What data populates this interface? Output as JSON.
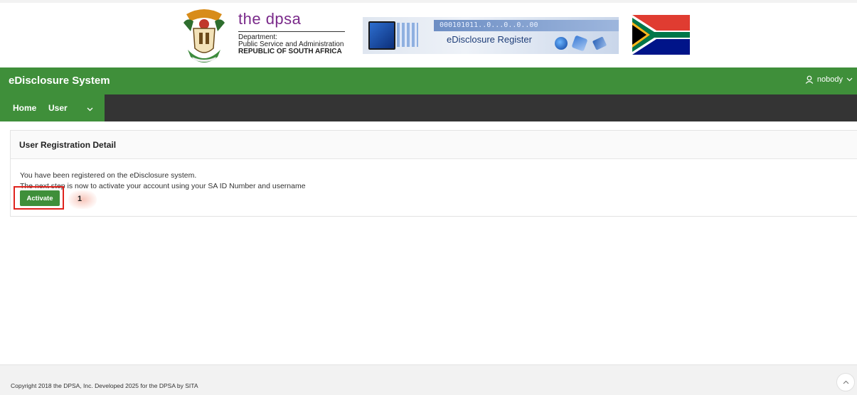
{
  "banner": {
    "dpsa_title": "the dpsa",
    "dpsa_line1": "Department:",
    "dpsa_line2": "Public Service and Administration",
    "dpsa_line3": "REPUBLIC OF SOUTH AFRICA",
    "register_digits": "000101011..0...0..0..00",
    "register_text": "eDisclosure Register"
  },
  "header": {
    "app_title": "eDisclosure System",
    "user_name": "nobody",
    "user_icon": "user-icon"
  },
  "nav": {
    "items": [
      {
        "label": "Home"
      },
      {
        "label": "User"
      }
    ]
  },
  "main": {
    "card_title": "User Registration Detail",
    "message_line1": "You have been registered on the eDisclosure system.",
    "message_line2": "The next step is now to activate your account using your SA ID Number and username",
    "activate_label": "Activate",
    "step_marker": "1"
  },
  "footer": {
    "copyright": "Copyright 2018 the DPSA, Inc. Developed 2025 for the DPSA by SITA"
  },
  "colors": {
    "brand_green": "#3f8f3a",
    "nav_dark": "#343434",
    "highlight_red": "#e0231d"
  }
}
